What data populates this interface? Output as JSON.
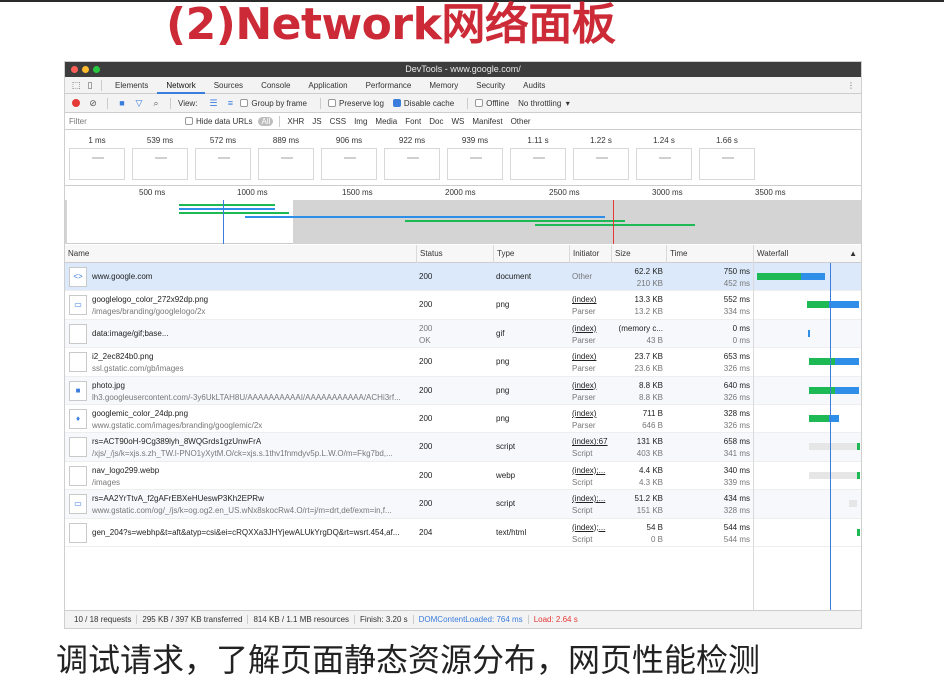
{
  "slide": {
    "title": "(2)Network网络面板",
    "caption": "调试请求，了解页面静态资源分布，网页性能检测"
  },
  "window": {
    "title": "DevTools - www.google.com/",
    "tabs": [
      "Elements",
      "Network",
      "Sources",
      "Console",
      "Application",
      "Performance",
      "Memory",
      "Security",
      "Audits"
    ],
    "active_tab": "Network",
    "menu_icon": "⋮"
  },
  "toolbar": {
    "view_label": "View:",
    "group_by_frame": "Group by frame",
    "preserve_log": "Preserve log",
    "disable_cache": "Disable cache",
    "offline": "Offline",
    "throttling": "No throttling"
  },
  "filter": {
    "placeholder": "Filter",
    "hide_data_urls": "Hide data URLs",
    "types": [
      "All",
      "XHR",
      "JS",
      "CSS",
      "Img",
      "Media",
      "Font",
      "Doc",
      "WS",
      "Manifest",
      "Other"
    ]
  },
  "filmstrip": {
    "times": [
      "1 ms",
      "539 ms",
      "572 ms",
      "889 ms",
      "906 ms",
      "922 ms",
      "939 ms",
      "1.11 s",
      "1.22 s",
      "1.24 s",
      "1.66 s"
    ]
  },
  "overview": {
    "ticks": [
      "500 ms",
      "1000 ms",
      "1500 ms",
      "2000 ms",
      "2500 ms",
      "3000 ms",
      "3500 ms"
    ]
  },
  "columns": [
    "Name",
    "Status",
    "Type",
    "Initiator",
    "Size",
    "Time",
    "Waterfall"
  ],
  "rows": [
    {
      "name": "www.google.com",
      "path": "",
      "status": "200",
      "status2": "",
      "type": "document",
      "initiator": "Other",
      "initiator2": "",
      "size": "62.2 KB",
      "size2": "210 KB",
      "time": "750 ms",
      "time2": "452 ms",
      "icon": "code-icon"
    },
    {
      "name": "googlelogo_color_272x92dp.png",
      "path": "/images/branding/googlelogo/2x",
      "status": "200",
      "status2": "",
      "type": "png",
      "initiator": "(index)",
      "initiator2": "Parser",
      "size": "13.3 KB",
      "size2": "13.2 KB",
      "time": "552 ms",
      "time2": "334 ms",
      "icon": "image-icon"
    },
    {
      "name": "data:image/gif;base...",
      "path": "",
      "status": "200",
      "status2": "OK",
      "type": "gif",
      "initiator": "(index)",
      "initiator2": "Parser",
      "size": "(memory c...",
      "size2": "43 B",
      "time": "0 ms",
      "time2": "0 ms",
      "icon": "file-icon"
    },
    {
      "name": "i2_2ec824b0.png",
      "path": "ssl.gstatic.com/gb/images",
      "status": "200",
      "status2": "",
      "type": "png",
      "initiator": "(index)",
      "initiator2": "Parser",
      "size": "23.7 KB",
      "size2": "23.6 KB",
      "time": "653 ms",
      "time2": "326 ms",
      "icon": "file-icon"
    },
    {
      "name": "photo.jpg",
      "path": "lh3.googleusercontent.com/-3y6UkLTAH8U/AAAAAAAAAAI/AAAAAAAAAAA/ACHi3rf...",
      "status": "200",
      "status2": "",
      "type": "png",
      "initiator": "(index)",
      "initiator2": "Parser",
      "size": "8.8 KB",
      "size2": "8.8 KB",
      "time": "640 ms",
      "time2": "326 ms",
      "icon": "photo-icon"
    },
    {
      "name": "googlemic_color_24dp.png",
      "path": "www.gstatic.com/images/branding/googlemic/2x",
      "status": "200",
      "status2": "",
      "type": "png",
      "initiator": "(index)",
      "initiator2": "Parser",
      "size": "711 B",
      "size2": "646 B",
      "time": "328 ms",
      "time2": "326 ms",
      "icon": "mic-icon"
    },
    {
      "name": "rs=ACT90oH-9Cg389lyh_8WQGrds1gzUnwFrA",
      "path": "/xjs/_/js/k=xjs.s.zh_TW.l-PNO1yXytM.O/ck=xjs.s.1thv1fnmdyv5p.L.W.O/m=Fkg7bd,...",
      "status": "200",
      "status2": "",
      "type": "script",
      "initiator": "(index):67",
      "initiator2": "Script",
      "size": "131 KB",
      "size2": "403 KB",
      "time": "658 ms",
      "time2": "341 ms",
      "icon": "file-icon"
    },
    {
      "name": "nav_logo299.webp",
      "path": "/images",
      "status": "200",
      "status2": "",
      "type": "webp",
      "initiator": "(index);...",
      "initiator2": "Script",
      "size": "4.4 KB",
      "size2": "4.3 KB",
      "time": "340 ms",
      "time2": "339 ms",
      "icon": "file-icon"
    },
    {
      "name": "rs=AA2YrTtvA_f2gAFrEBXeHUeswP3Kh2EPRw",
      "path": "www.gstatic.com/og/_/js/k=og.og2.en_US.wNx8skocRw4.O/rt=j/m=drt,def/exm=in,f...",
      "status": "200",
      "status2": "",
      "type": "script",
      "initiator": "(index);...",
      "initiator2": "Script",
      "size": "51.2 KB",
      "size2": "151 KB",
      "time": "434 ms",
      "time2": "328 ms",
      "icon": "image-icon"
    },
    {
      "name": "gen_204?s=webhp&t=aft&atyp=csi&ei=cRQXXa3JHYjewALUkYrgDQ&rt=wsrt.454,af...",
      "path": "",
      "status": "204",
      "status2": "",
      "type": "text/html",
      "initiator": "(index);...",
      "initiator2": "Script",
      "size": "54 B",
      "size2": "0 B",
      "time": "544 ms",
      "time2": "544 ms",
      "icon": "file-icon"
    }
  ],
  "status_bar": {
    "requests": "10 / 18 requests",
    "transferred": "295 KB / 397 KB transferred",
    "resources": "814 KB / 1.1 MB resources",
    "finish": "Finish: 3.20 s",
    "dom_loaded": "DOMContentLoaded: 764 ms",
    "load": "Load: 2.64 s"
  },
  "colors": {
    "title_red": "#cc2a36",
    "accent_blue": "#3b7ddd",
    "waterfall_green": "#1db954",
    "waterfall_blue": "#2f8fe8",
    "load_red": "#e53935"
  }
}
